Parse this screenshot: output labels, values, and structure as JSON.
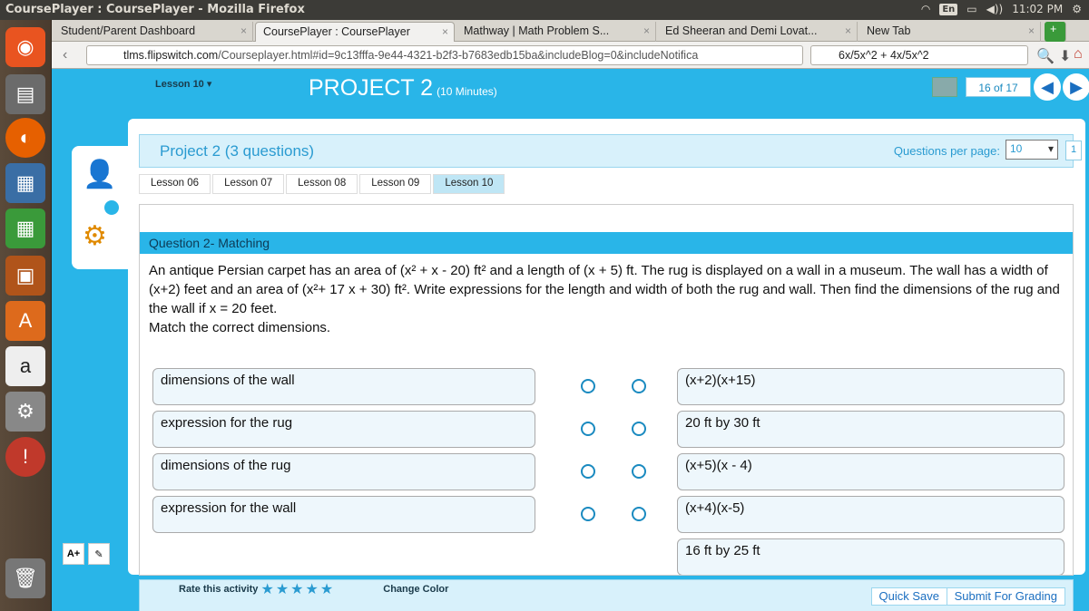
{
  "os": {
    "window_title": "CoursePlayer : CoursePlayer - Mozilla Firefox",
    "lang": "En",
    "time": "11:02 PM"
  },
  "browser": {
    "tabs": [
      {
        "label": "Student/Parent Dashboard"
      },
      {
        "label": "CoursePlayer : CoursePlayer"
      },
      {
        "label": "Mathway | Math Problem S..."
      },
      {
        "label": "Ed Sheeran and Demi Lovat..."
      },
      {
        "label": "New Tab"
      }
    ],
    "url_domain": "tlms.flipswitch.com",
    "url_rest": "/Courseplayer.html#id=9c13fffa-9e44-4321-b2f3-b7683edb15ba&includeBlog=0&includeNotifica",
    "search_query": "6x/5x^2 + 4x/5x^2"
  },
  "header": {
    "lesson": "Lesson 10",
    "project": "PROJECT 2",
    "duration": "(10 Minutes)",
    "counter": "16 of 17"
  },
  "project_bar": {
    "title": "Project 2 (3 questions)",
    "qpp_label": "Questions per page:",
    "qpp_value": "10",
    "page": "1"
  },
  "crumbs": [
    "Lesson 06",
    "Lesson 07",
    "Lesson 08",
    "Lesson 09",
    "Lesson 10"
  ],
  "question": {
    "header": "Question 2- Matching",
    "text_1": "An antique Persian carpet has an area of (x² + x - 20) ft² and a length of (x + 5) ft. The rug is displayed on a wall in a museum. The wall has a width of (x+2) feet and an area of (x²+ 17 x + 30) ft². Write expressions for the length and width of both the rug and wall. Then find the dimensions of the rug and the wall if x = 20 feet.",
    "text_2": "Match the correct dimensions.",
    "left": [
      "dimensions of the wall",
      "expression for the rug",
      "dimensions of the rug",
      "expression for the wall"
    ],
    "right": [
      "(x+2)(x+15)",
      "20 ft by 30 ft",
      "(x+5)(x - 4)",
      "(x+4)(x-5)",
      "16 ft by 25 ft"
    ]
  },
  "footer": {
    "quick_save": "Quick Save",
    "submit": "Submit For Grading"
  },
  "bottom": {
    "rate": "Rate this activity",
    "change_color": "Change Color"
  },
  "tools": {
    "font_size": "A+"
  }
}
